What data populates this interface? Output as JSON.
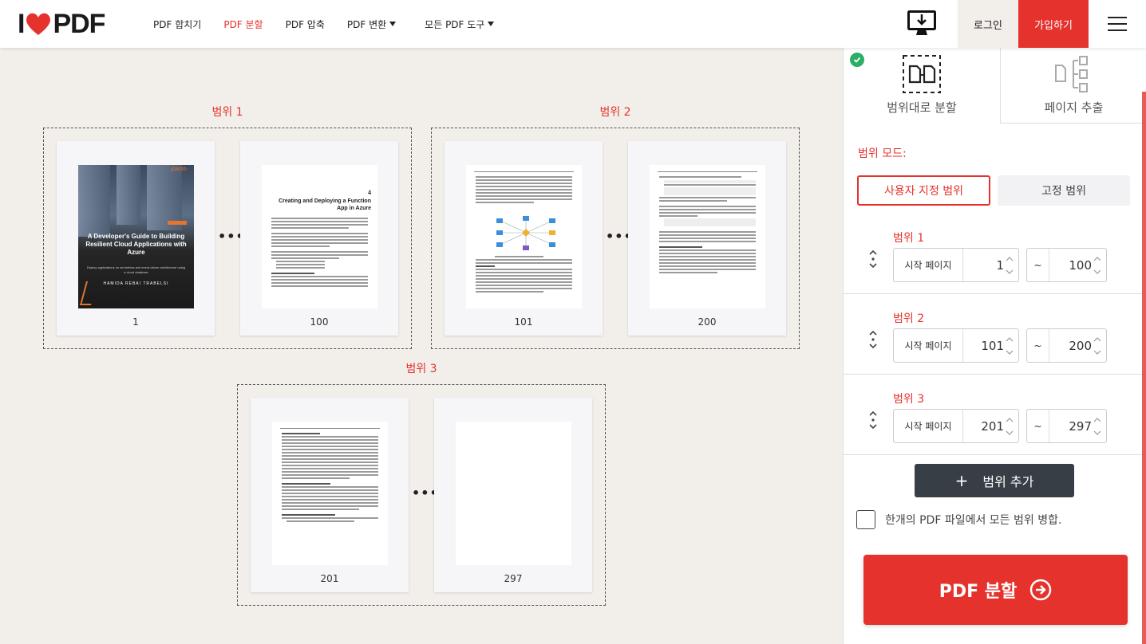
{
  "header": {
    "logo_left": "I",
    "logo_right": "PDF",
    "nav": [
      {
        "label": "PDF 합치기",
        "active": false,
        "dropdown": false
      },
      {
        "label": "PDF 분할",
        "active": true,
        "dropdown": false
      },
      {
        "label": "PDF 압축",
        "active": false,
        "dropdown": false
      },
      {
        "label": "PDF 변환",
        "active": false,
        "dropdown": true
      },
      {
        "label": "모든 PDF 도구",
        "active": false,
        "dropdown": true
      }
    ],
    "desktop_icon": "desktop-download-icon",
    "login": "로그인",
    "signup": "가입하기",
    "menu_icon": "hamburger-menu-icon"
  },
  "workspace": {
    "ranges": [
      {
        "title": "범위 1",
        "first_page": "1",
        "last_page": "100"
      },
      {
        "title": "범위 2",
        "first_page": "101",
        "last_page": "200"
      },
      {
        "title": "범위 3",
        "first_page": "201",
        "last_page": "297"
      }
    ],
    "ellipsis": "•••",
    "thumb_texts": {
      "book_brand": "‹packt›",
      "book_title": "A Developer's Guide to Building Resilient Cloud Applications with Azure",
      "book_subtitle": "Deploy applications on serverless and event-driven architecture using a cloud database",
      "book_author": "HAMIDA REBAI TRABELSI",
      "chapter_num": "4",
      "chapter_title": "Creating and Deploying a Function App in Azure"
    }
  },
  "panel": {
    "tabs": [
      {
        "label": "범위대로 분할",
        "icon": "split-by-range-icon",
        "selected": true
      },
      {
        "label": "페이지 추출",
        "icon": "extract-pages-icon",
        "selected": false
      }
    ],
    "mode_label": "범위 모드:",
    "mode_custom": "사용자 지정 범위",
    "mode_fixed": "고정 범위",
    "start_label": "시작 페이지",
    "tilde": "~",
    "range_rows": [
      {
        "title": "범위 1",
        "from": "1",
        "to": "100"
      },
      {
        "title": "범위 2",
        "from": "101",
        "to": "200"
      },
      {
        "title": "범위 3",
        "from": "201",
        "to": "297"
      }
    ],
    "add_range": "범위 추가",
    "add_plus": "+",
    "merge_label": "한개의 PDF 파일에서 모든 범위 병합.",
    "split_button": "PDF 분할"
  },
  "colors": {
    "brand": "#e5322d",
    "dark_button": "#383e45",
    "success": "#2bae66"
  }
}
